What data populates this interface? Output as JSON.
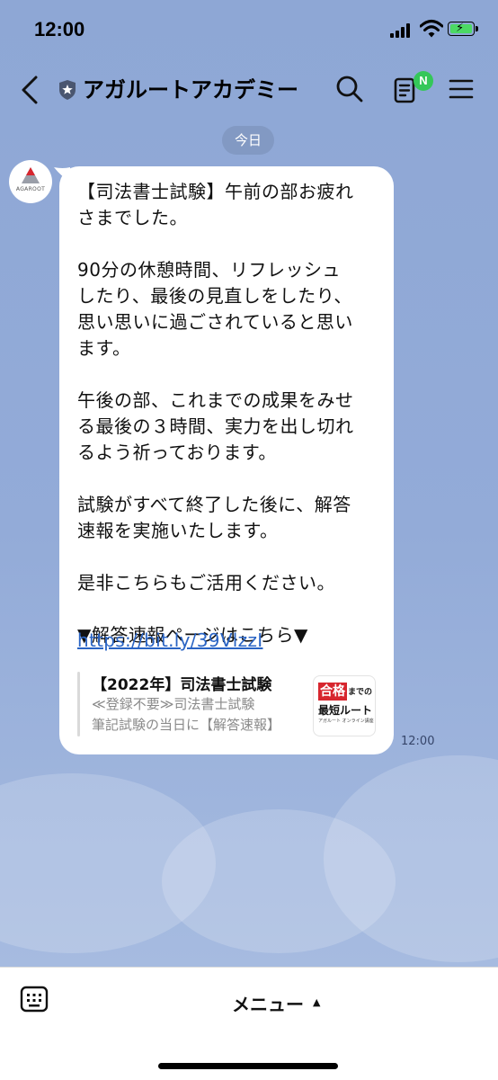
{
  "status_bar": {
    "time": "12:00"
  },
  "header": {
    "title": "アガルートアカデミー",
    "notification_badge": "N",
    "icons": [
      "back-chevron-icon",
      "shield-star-icon",
      "search-icon",
      "notes-icon",
      "menu-icon"
    ]
  },
  "chat": {
    "date_separator": "今日",
    "avatar_text": "AGAROOT",
    "message": {
      "text": "【司法書士試験】午前の部お疲れ\nさまでした。\n\n90分の休憩時間、リフレッシュ\nしたり、最後の見直しをしたり、\n思い思いに過ごされていると思い\nます。\n\n午後の部、これまでの成果をみせ\nる最後の３時間、実力を出し切れ\nるよう祈っております。\n\n試験がすべて終了した後に、解答\n速報を実施いたします。\n\n是非こちらもご活用ください。\n\n▼解答速報ページはこちら▼",
      "link": "https://bit.ly/39VlzzI",
      "preview": {
        "title": "【2022年】司法書士試験",
        "description_line1": "≪登録不要≫司法書士試験",
        "description_line2": "筆記試験の当日に【解答速報】",
        "thumbnail": {
          "red_label": "合格",
          "made": "までの",
          "main": "最短ルート",
          "small": "アガルート オンライン講座"
        }
      },
      "time": "12:00"
    }
  },
  "bottom_bar": {
    "menu_label": "メニュー",
    "menu_arrow": "▲"
  },
  "colors": {
    "background": "#8fa8d6",
    "bubble": "#ffffff",
    "link": "#2a64c4",
    "badge": "#34c759",
    "thumbnail_red": "#d7262e"
  }
}
